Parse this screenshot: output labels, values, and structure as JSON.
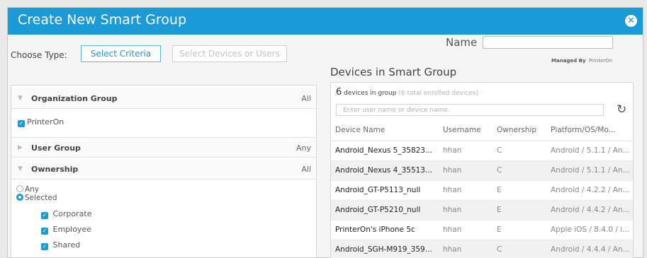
{
  "title": "Create New Smart Group",
  "choose_type_label": "Choose Type:",
  "type_buttons": {
    "criteria": "Select Criteria",
    "devices": "Select Devices or Users"
  },
  "name": {
    "label": "Name",
    "value": ""
  },
  "managed_by": {
    "label": "Managed By",
    "value": "PrinterOn"
  },
  "devices_heading": "Devices in Smart Group",
  "criteria": {
    "org_group": {
      "title": "Organization Group",
      "value": "All",
      "item": "PrinterOn"
    },
    "user_group": {
      "title": "User Group",
      "value": "Any"
    },
    "ownership": {
      "title": "Ownership",
      "value": "All",
      "radio_any": "Any",
      "radio_selected": "Selected",
      "options": [
        "Corporate",
        "Employee",
        "Shared"
      ]
    }
  },
  "device_panel": {
    "count": "6",
    "count_label": "devices in group",
    "total_note": "(6 total enrolled devices)",
    "search_placeholder": "Enter user name or device name.",
    "columns": [
      "Device Name",
      "Username",
      "Ownership",
      "Platform/OS/Mo..."
    ],
    "rows": [
      [
        "Android_Nexus 5_35823...",
        "hhan",
        "C",
        "Android / 5.1.1 / An..."
      ],
      [
        "Android_Nexus 4_35513...",
        "hhan",
        "C",
        "Android / 5.1.1 / An..."
      ],
      [
        "Android_GT-P5113_null",
        "hhan",
        "E",
        "Android / 4.2.2 / An..."
      ],
      [
        "Android_GT-P5210_null",
        "hhan",
        "E",
        "Android / 4.4.2 / An..."
      ],
      [
        "PrinterOn's iPhone 5c",
        "hhan",
        "E",
        "Apple iOS / 8.4.0 / i..."
      ],
      [
        "Android_SGH-M919_359...",
        "hhan",
        "C",
        "Android / 4.4.4 / An..."
      ]
    ]
  },
  "colors": {
    "accent": "#1a9ad6"
  },
  "icons": {
    "close": "close-circle-icon",
    "refresh": "refresh-icon"
  }
}
